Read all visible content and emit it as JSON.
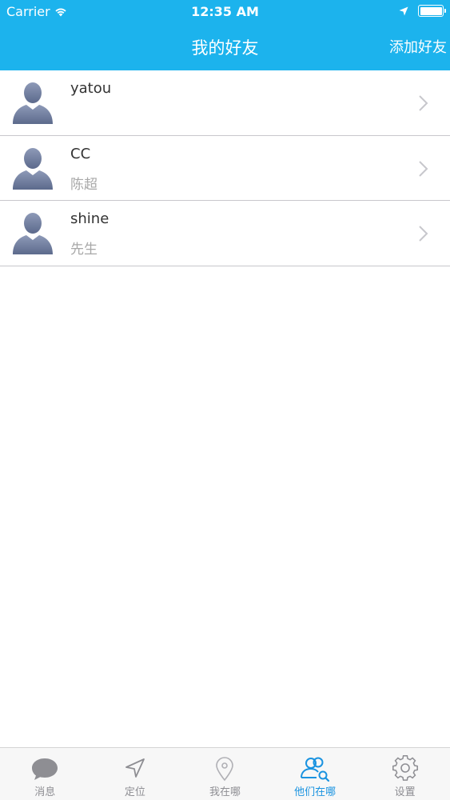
{
  "status_bar": {
    "carrier": "Carrier",
    "time": "12:35 AM",
    "battery_level": 1.0
  },
  "nav": {
    "title": "我的好友",
    "add_label": "添加好友"
  },
  "friends": [
    {
      "name": "yatou",
      "note": ""
    },
    {
      "name": "CC",
      "note": "陈超"
    },
    {
      "name": "shine",
      "note": "先生"
    }
  ],
  "tabs": [
    {
      "label": "消息",
      "icon": "chat-bubble-icon",
      "active": false
    },
    {
      "label": "定位",
      "icon": "navigation-arrow-icon",
      "active": false
    },
    {
      "label": "我在哪",
      "icon": "location-pin-icon",
      "active": false
    },
    {
      "label": "他们在哪",
      "icon": "people-search-icon",
      "active": true
    },
    {
      "label": "设置",
      "icon": "gear-icon",
      "active": false
    }
  ],
  "colors": {
    "accent": "#1cb3ed",
    "active_tab": "#1a93e0",
    "inactive_tab": "#8e8e93"
  }
}
